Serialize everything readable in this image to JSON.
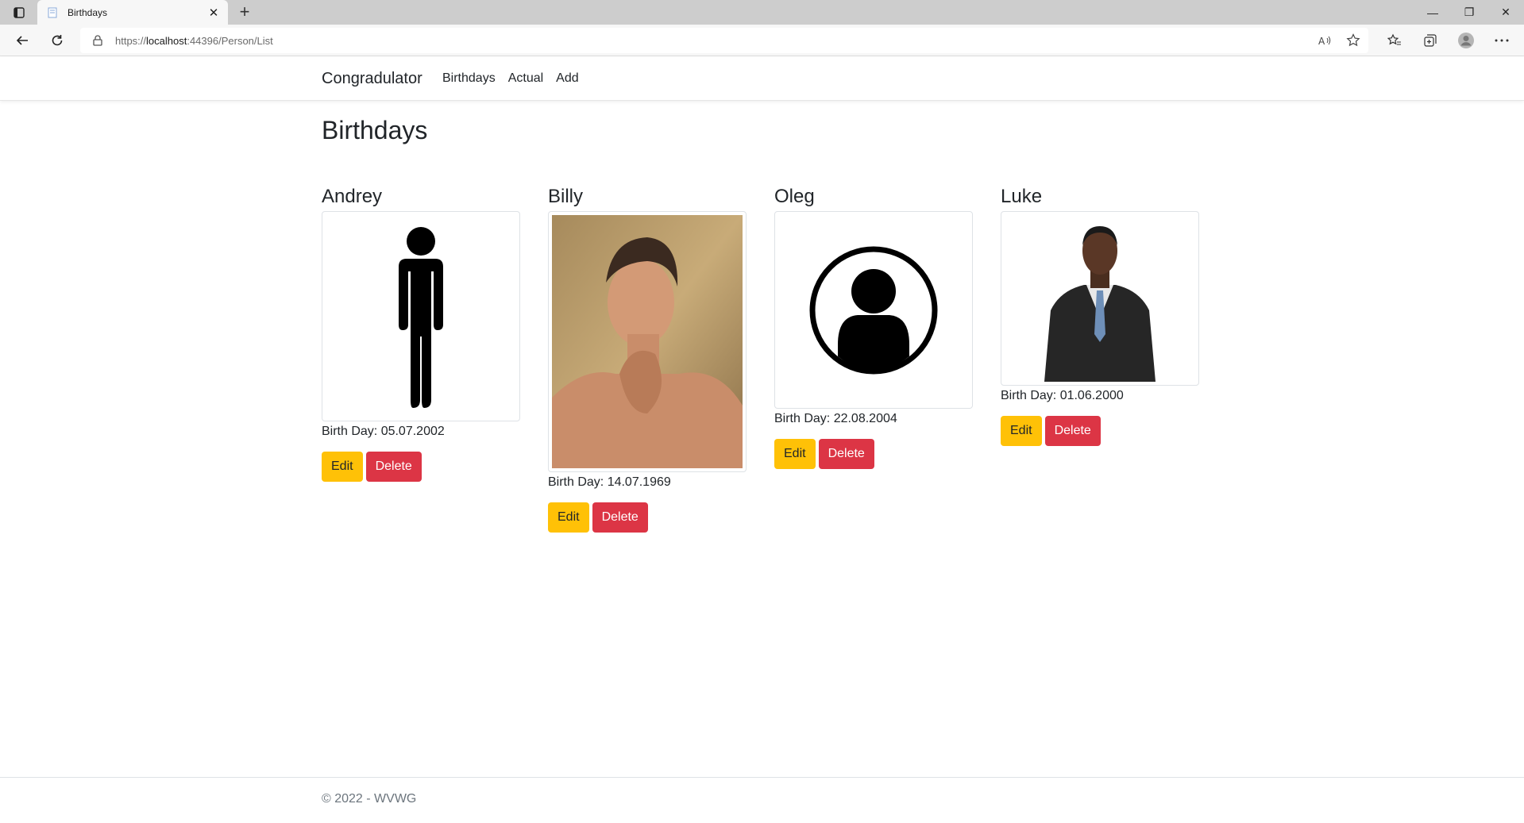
{
  "browser": {
    "tab_title": "Birthdays",
    "tab_close": "✕",
    "new_tab": "+",
    "url_prefix": "https://",
    "url_host": "localhost",
    "url_rest": ":44396/Person/List",
    "window_controls": {
      "minimize": "—",
      "restore": "❐",
      "close": "✕"
    }
  },
  "navbar": {
    "brand": "Congradulator",
    "links": [
      "Birthdays",
      "Actual",
      "Add"
    ]
  },
  "heading": "Birthdays",
  "people": [
    {
      "name": "Andrey",
      "birthday": "Birth Day: 05.07.2002",
      "photo": "standing-person-icon",
      "edit": "Edit",
      "delete": "Delete"
    },
    {
      "name": "Billy",
      "birthday": "Birth Day: 14.07.1969",
      "photo": "man-photo",
      "edit": "Edit",
      "delete": "Delete"
    },
    {
      "name": "Oleg",
      "birthday": "Birth Day: 22.08.2004",
      "photo": "user-circle-icon",
      "edit": "Edit",
      "delete": "Delete"
    },
    {
      "name": "Luke",
      "birthday": "Birth Day: 01.06.2000",
      "photo": "businessman-photo",
      "edit": "Edit",
      "delete": "Delete"
    }
  ],
  "footer": "© 2022 - WVWG",
  "colors": {
    "edit": "#ffc107",
    "delete": "#dc3545"
  }
}
